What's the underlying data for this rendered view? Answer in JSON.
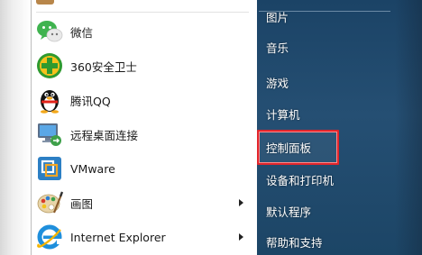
{
  "left_pane": {
    "items": [
      {
        "label": "微信",
        "icon": "wechat-icon",
        "has_submenu": false
      },
      {
        "label": "360安全卫士",
        "icon": "360-security-icon",
        "has_submenu": false
      },
      {
        "label": "腾讯QQ",
        "icon": "qq-penguin-icon",
        "has_submenu": false
      },
      {
        "label": "远程桌面连接",
        "icon": "remote-desktop-icon",
        "has_submenu": false
      },
      {
        "label": "VMware",
        "icon": "vmware-icon",
        "has_submenu": false
      },
      {
        "label": "画图",
        "icon": "paint-icon",
        "has_submenu": true
      },
      {
        "label": "Internet Explorer",
        "icon": "internet-explorer-icon",
        "has_submenu": true
      }
    ]
  },
  "right_pane": {
    "items": [
      {
        "label": "图片"
      },
      {
        "label": "音乐"
      },
      {
        "label": "游戏"
      },
      {
        "label": "计算机"
      },
      {
        "label": "控制面板",
        "highlighted": true
      },
      {
        "label": "设备和打印机"
      },
      {
        "label": "默认程序"
      },
      {
        "label": "帮助和支持"
      }
    ]
  },
  "colors": {
    "right_pane_bg": "#254f73",
    "highlight_border": "#e0252c",
    "left_pane_bg": "#ffffff"
  }
}
